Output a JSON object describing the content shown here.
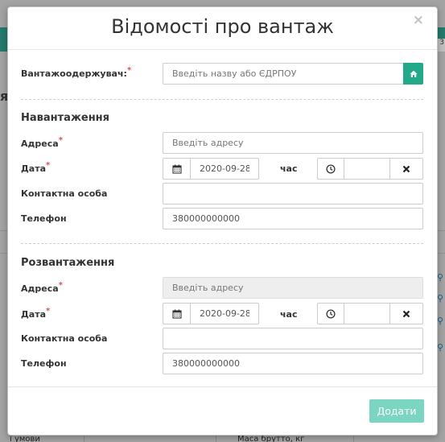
{
  "background": {
    "tab_text": "3",
    "letter": "я",
    "bottom_left_text": "ї умови",
    "bottom_mid_text": "Маса брутто, кг"
  },
  "modal": {
    "title": "Відомості про вантаж",
    "close_symbol": "×",
    "consignee": {
      "label": "Вантажоодержувач:",
      "required_mark": "*",
      "placeholder": "Введіть назву або ЄДРПОУ"
    },
    "loading": {
      "section_title": "Навантаження",
      "address_label": "Адреса",
      "address_placeholder": "Введіть адресу",
      "date_label": "Дата",
      "date_value": "2020-09-28",
      "time_label": "час",
      "time_value": "",
      "contact_label": "Контактна особа",
      "contact_value": "",
      "phone_label": "Телефон",
      "phone_value": "380000000000",
      "required_mark": "*"
    },
    "unloading": {
      "section_title": "Розвантаження",
      "address_label": "Адреса",
      "address_placeholder": "Введіть адресу",
      "date_label": "Дата",
      "date_value": "2020-09-28",
      "time_label": "час",
      "time_value": "",
      "contact_label": "Контактна особа",
      "contact_value": "",
      "phone_label": "Телефон",
      "phone_value": "380000000000",
      "required_mark": "*"
    },
    "submit_label": "Додати"
  },
  "colors": {
    "accent": "#21a98a",
    "submit_disabled": "#7ad6c1",
    "required": "#d9534f"
  },
  "icons": {
    "home": "home-icon",
    "calendar": "calendar-icon",
    "clock": "clock-icon",
    "clear": "close-icon"
  }
}
